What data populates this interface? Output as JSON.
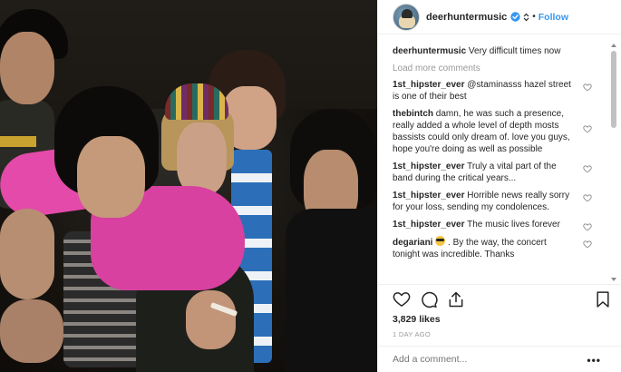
{
  "post": {
    "username": "deerhuntermusic",
    "verified": true,
    "separator": "•",
    "follow_label": "Follow"
  },
  "caption": {
    "username": "deerhuntermusic",
    "text": "Very difficult times now"
  },
  "load_more": "Load more comments",
  "comments": [
    {
      "username": "1st_hipster_ever",
      "text": "@staminasss hazel street is one of their best"
    },
    {
      "username": "thebintch",
      "text": "damn, he was such a presence, really added a whole level of depth mosts bassists could only dream of. love you guys, hope you're doing as well as possible"
    },
    {
      "username": "1st_hipster_ever",
      "text": "Truly a vital part of the band during the critical years..."
    },
    {
      "username": "1st_hipster_ever",
      "text": "Horrible news really sorry for your loss, sending my condolences."
    },
    {
      "username": "1st_hipster_ever",
      "text": "The music lives forever"
    },
    {
      "username": "degariani",
      "text": ". By the way, the concert tonight was incredible. Thanks"
    }
  ],
  "actions": {
    "like_icon": "heart-icon",
    "comment_icon": "comment-bubble-icon",
    "share_icon": "share-upload-icon",
    "save_icon": "bookmark-icon"
  },
  "likes": "3,829 likes",
  "time_ago": "1 DAY AGO",
  "add_comment_placeholder": "Add a comment...",
  "more_options": "•••",
  "colors": {
    "link_blue": "#3897f0",
    "text": "#262626",
    "muted": "#999999",
    "border": "#efefef"
  }
}
